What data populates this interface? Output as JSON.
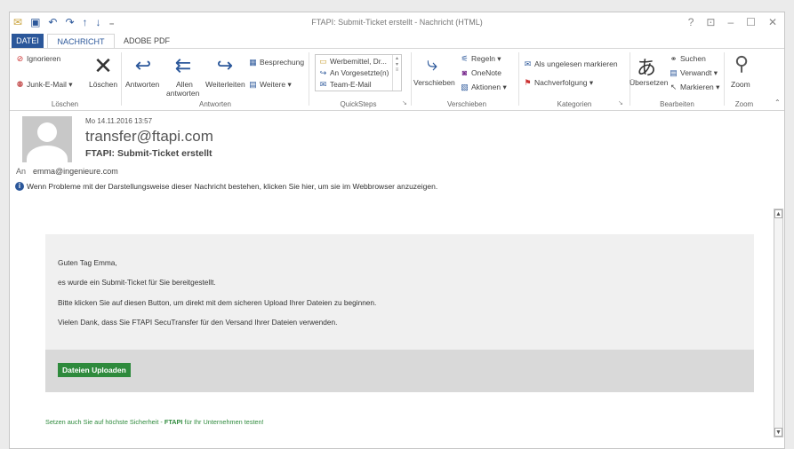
{
  "window": {
    "title": "FTAPI: Submit-Ticket erstellt - Nachricht (HTML)",
    "controls": [
      "?",
      "⊡",
      "–",
      "☐",
      "✕"
    ]
  },
  "tabs": [
    {
      "label": "DATEI"
    },
    {
      "label": "NACHRICHT"
    },
    {
      "label": "ADOBE PDF"
    }
  ],
  "ribbon": {
    "loeschen": {
      "label": "Löschen",
      "ignorieren": "Ignorieren",
      "junk": "Junk-E-Mail ▾",
      "loeschen_btn": "Löschen"
    },
    "antworten": {
      "label": "Antworten",
      "antworten_btn": "Antworten",
      "allen_1": "Allen",
      "allen_2": "antworten",
      "weiterleiten": "Weiterleiten",
      "besprechung": "Besprechung",
      "weitere": "Weitere ▾"
    },
    "quicksteps": {
      "label": "QuickSteps",
      "items": [
        "Werbemittel, Dr...",
        "An Vorgesetzte(n)",
        "Team-E-Mail"
      ]
    },
    "verschieben": {
      "label": "Verschieben",
      "verschieben_btn": "Verschieben",
      "regeln": "Regeln ▾",
      "onenote": "OneNote",
      "aktionen": "Aktionen ▾"
    },
    "kategorien": {
      "label": "Kategorien",
      "ungelesen": "Als ungelesen markieren",
      "nachverfolgung": "Nachverfolgung ▾"
    },
    "bearbeiten": {
      "label": "Bearbeiten",
      "uebersetzen": "Übersetzen",
      "suchen": "Suchen",
      "verwandt": "Verwandt ▾",
      "markieren": "Markieren ▾"
    },
    "zoom": {
      "label": "Zoom",
      "zoom_btn": "Zoom"
    }
  },
  "message": {
    "date": "Mo 14.11.2016 13:57",
    "sender": "transfer@ftapi.com",
    "subject": "FTAPI: Submit-Ticket erstellt",
    "to_label": "An",
    "to_value": "emma@ingenieure.com",
    "info": "Wenn Probleme mit der Darstellungsweise dieser Nachricht bestehen, klicken Sie hier, um sie im Webbrowser anzuzeigen."
  },
  "body": {
    "greeting": "Guten Tag Emma,",
    "line1": "es wurde ein Submit-Ticket für Sie bereitgestellt.",
    "line2": "Bitte klicken Sie auf diesen Button, um direkt mit dem sicheren Upload Ihrer Dateien zu beginnen.",
    "line3": "Vielen Dank, dass Sie FTAPI SecuTransfer für den Versand Ihrer Dateien verwenden.",
    "button": "Dateien Uploaden",
    "footer_pre": "Setzen auch Sie auf höchste Sicherheit - ",
    "footer_brand": "FTAPI",
    "footer_post": " für Ihr Unternehmen testen!"
  }
}
